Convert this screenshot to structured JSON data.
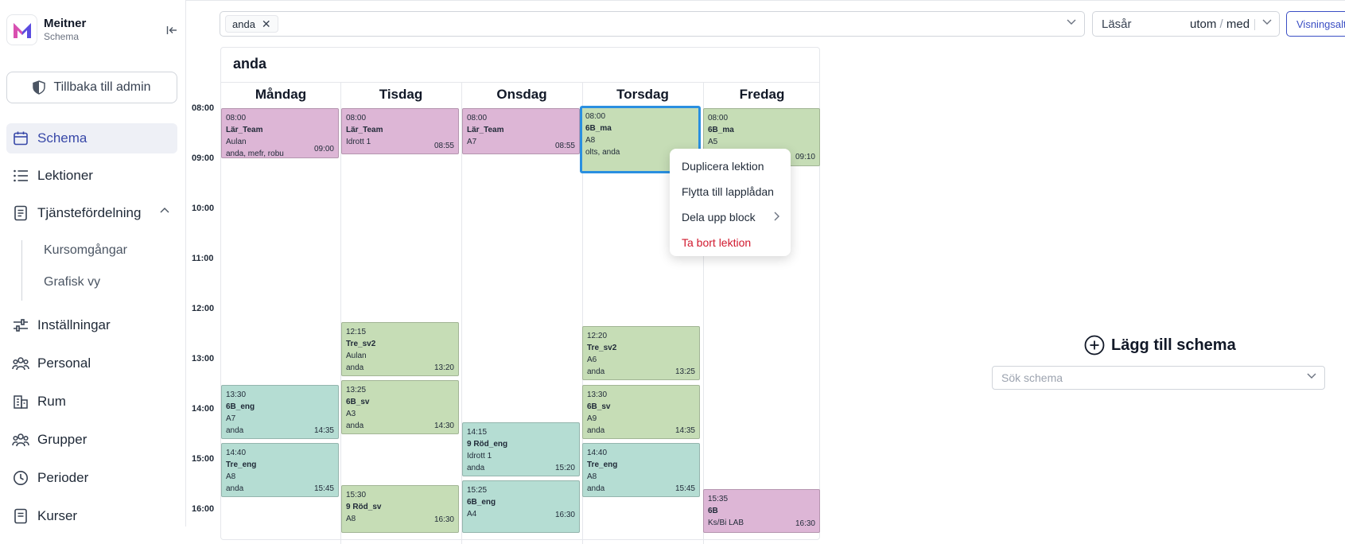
{
  "brand": {
    "name": "Meitner",
    "subtitle": "Schema"
  },
  "admin_button": "Tillbaka till admin",
  "nav": {
    "schema": "Schema",
    "lektioner": "Lektioner",
    "tjanstefordelning": "Tjänstefördelning",
    "kursomgangar": "Kursomgångar",
    "grafisk_vy": "Grafisk vy",
    "installningar": "Inställningar",
    "personal": "Personal",
    "rum": "Rum",
    "grupper": "Grupper",
    "perioder": "Perioder",
    "kurser": "Kurser"
  },
  "filter": {
    "chip": "anda"
  },
  "year": {
    "label": "Läsår",
    "opt_a": "utom",
    "sep": "/",
    "opt_b": "med"
  },
  "visning_button": "Visningsalternativ",
  "schedule": {
    "title": "anda",
    "days": [
      "Måndag",
      "Tisdag",
      "Onsdag",
      "Torsdag",
      "Fredag"
    ],
    "times": [
      "08:00",
      "09:00",
      "10:00",
      "11:00",
      "12:00",
      "13:00",
      "14:00",
      "15:00",
      "16:00"
    ],
    "lessons": {
      "mon1": {
        "start": "08:00",
        "name": "Lär_Team",
        "room": "Aulan",
        "teachers": "anda, mefr, robu",
        "end": "09:00"
      },
      "tue1": {
        "start": "08:00",
        "name": "Lär_Team",
        "room": "Idrott 1",
        "end": "08:55"
      },
      "wed1": {
        "start": "08:00",
        "name": "Lär_Team",
        "room": "A7",
        "end": "08:55"
      },
      "thu1": {
        "start": "08:00",
        "name": "6B_ma",
        "room": "A8",
        "teachers": "olts, anda"
      },
      "fri1": {
        "start": "08:00",
        "name": "6B_ma",
        "room": "A5",
        "end": "09:10"
      },
      "tue2": {
        "start": "12:15",
        "name": "Tre_sv2",
        "room": "Aulan",
        "teachers": "anda",
        "end": "13:20"
      },
      "thu2": {
        "start": "12:20",
        "name": "Tre_sv2",
        "room": "A6",
        "teachers": "anda",
        "end": "13:25"
      },
      "tue3": {
        "start": "13:25",
        "name": "6B_sv",
        "room": "A3",
        "teachers": "anda",
        "end": "14:30"
      },
      "mon2": {
        "start": "13:30",
        "name": "6B_eng",
        "room": "A7",
        "teachers": "anda",
        "end": "14:35"
      },
      "thu3": {
        "start": "13:30",
        "name": "6B_sv",
        "room": "A9",
        "teachers": "anda",
        "end": "14:35"
      },
      "wed2": {
        "start": "14:15",
        "name": "9 Röd_eng",
        "room": "Idrott 1",
        "teachers": "anda",
        "end": "15:20"
      },
      "mon3": {
        "start": "14:40",
        "name": "Tre_eng",
        "room": "A8",
        "teachers": "anda",
        "end": "15:45"
      },
      "thu4": {
        "start": "14:40",
        "name": "Tre_eng",
        "room": "A8",
        "teachers": "anda",
        "end": "15:45"
      },
      "wed3": {
        "start": "15:25",
        "name": "6B_eng",
        "room": "A4",
        "end": "16:30"
      },
      "tue4": {
        "start": "15:30",
        "name": "9 Röd_sv",
        "room": "A8",
        "end": "16:30"
      },
      "fri2": {
        "start": "15:35",
        "name": "6B",
        "room": "Ks/Bi LAB",
        "end": "16:30"
      }
    }
  },
  "context_menu": {
    "duplicate": "Duplicera lektion",
    "move": "Flytta till lapplådan",
    "split": "Dela upp block",
    "delete": "Ta bort lektion"
  },
  "right_panel": {
    "add_schedule": "Lägg till schema",
    "search_placeholder": "Sök schema"
  },
  "colors": {
    "accent": "#3848a8",
    "pink": "#ddb6d6",
    "green": "#c6ddb6",
    "teal": "#b5ddd3",
    "danger": "#d1192e",
    "selected": "#2a8fe0"
  }
}
